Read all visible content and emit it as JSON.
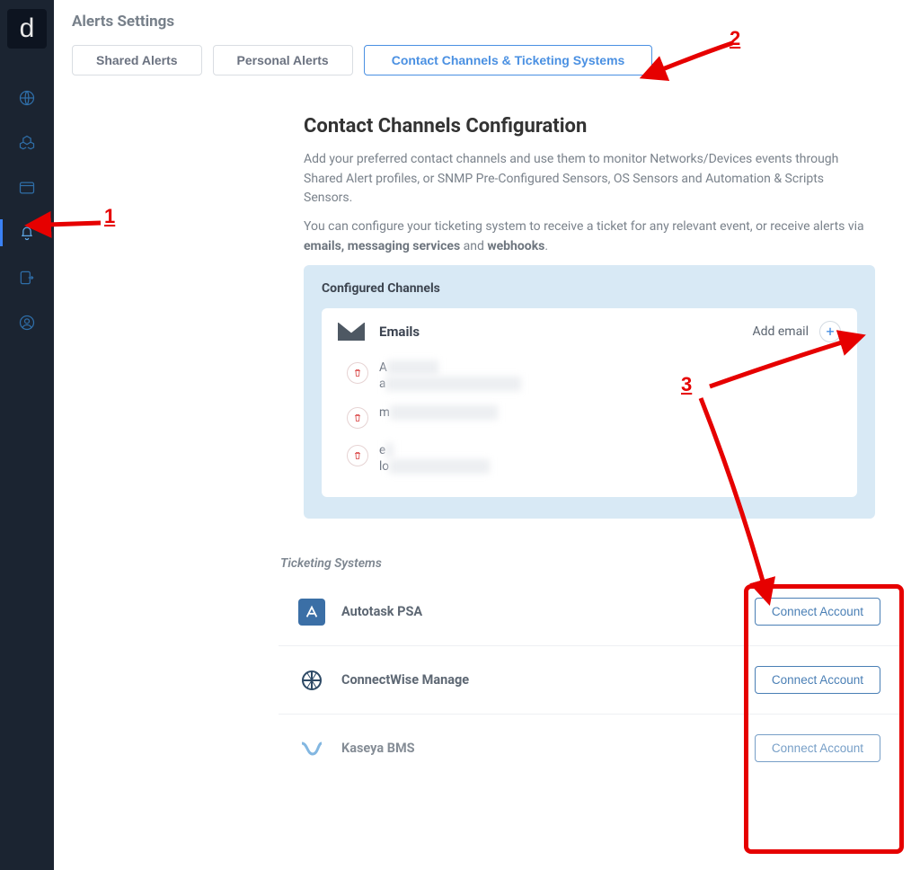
{
  "page": {
    "title": "Alerts Settings"
  },
  "tabs": {
    "shared": "Shared Alerts",
    "personal": "Personal Alerts",
    "channels": "Contact Channels & Ticketing Systems"
  },
  "config_card": {
    "heading": "Contact Channels Configuration",
    "para1_a": "Add your preferred contact channels and use them to monitor Networks/Devices events through Shared Alert profiles, or SNMP Pre-Configured Sensors, OS Sensors and Automation & Scripts Sensors.",
    "para2_a": "You can configure your ticketing system to receive a ticket for any relevant event, or receive alerts via ",
    "para2_b": "emails, messaging services",
    "para2_c": " and ",
    "para2_d": "webhooks",
    "para2_e": "."
  },
  "configured": {
    "title": "Configured Channels",
    "emails_label": "Emails",
    "add_email": "Add email",
    "rows": [
      {
        "l1a": "A",
        "l1b": "redacted",
        "l2a": "a",
        "l2b": "redacted@example.com"
      },
      {
        "l1a": "m",
        "l1b": "redacted@example"
      },
      {
        "l1a": "e",
        "l1b": "r",
        "l2a": "lo",
        "l2b": "redacted text here"
      }
    ]
  },
  "ticketing": {
    "heading": "Ticketing Systems",
    "connect_label": "Connect Account",
    "systems": [
      {
        "name": "Autotask PSA",
        "badge_bg": "#3b6fa6",
        "badge_glyph": "A"
      },
      {
        "name": "ConnectWise Manage",
        "badge_bg": "#ffffff",
        "badge_glyph": "CW"
      },
      {
        "name": "Kaseya BMS",
        "badge_bg": "#ffffff",
        "badge_glyph": "K"
      }
    ]
  },
  "annotations": {
    "n1": "1",
    "n2": "2",
    "n3": "3"
  }
}
